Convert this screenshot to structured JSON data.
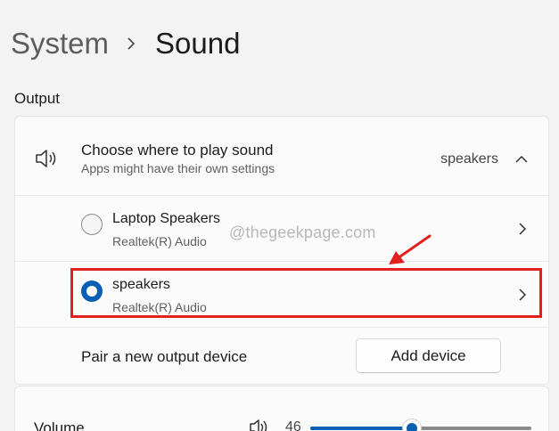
{
  "breadcrumb": {
    "parent": "System",
    "current": "Sound"
  },
  "output_section": {
    "label": "Output",
    "header": {
      "title": "Choose where to play sound",
      "subtitle": "Apps might have their own settings",
      "selected": "speakers",
      "icon": "speaker-icon"
    },
    "devices": [
      {
        "name": "Laptop Speakers",
        "subtitle": "Realtek(R) Audio",
        "selected": false
      },
      {
        "name": "speakers",
        "subtitle": "Realtek(R) Audio",
        "selected": true
      }
    ],
    "pair": {
      "label": "Pair a new output device",
      "button": "Add device"
    }
  },
  "volume": {
    "label": "Volume",
    "value": "46",
    "level": 0.46
  },
  "watermark": "@thegeekpage.com",
  "colors": {
    "accent": "#0a5fb4",
    "annotation": "#e0211f"
  }
}
